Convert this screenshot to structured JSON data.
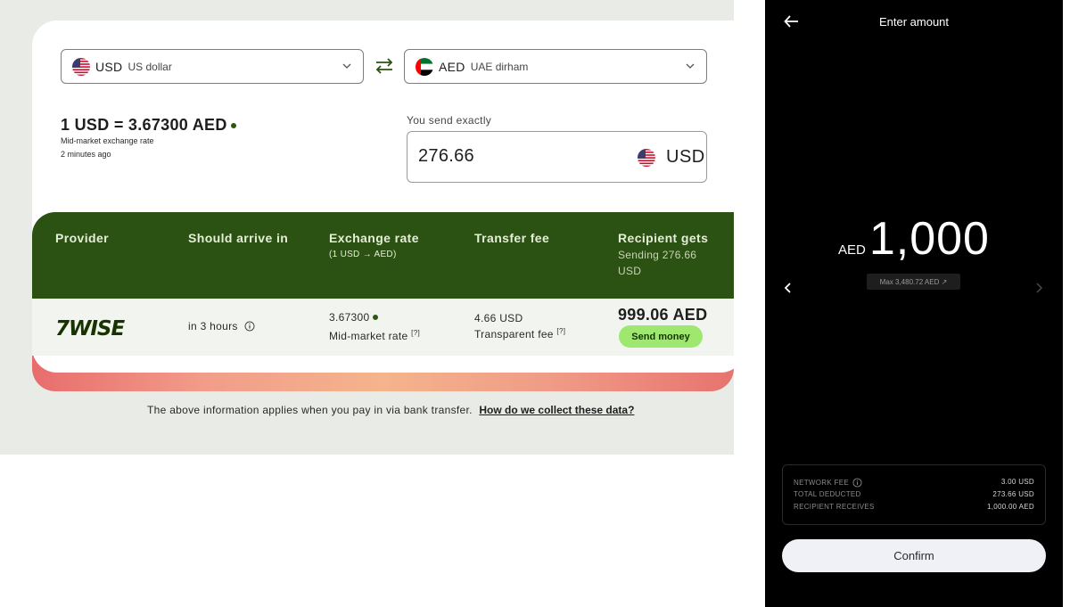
{
  "converter": {
    "from": {
      "code": "USD",
      "name": "US dollar",
      "flag_icon": "us-flag-icon"
    },
    "to": {
      "code": "AED",
      "name": "UAE dirham",
      "flag_icon": "uae-flag-icon"
    },
    "rate_text": "1 USD = 3.67300 AED",
    "rate_note": "Mid-market exchange rate",
    "rate_time": "2 minutes ago",
    "send_label": "You send exactly",
    "send_amount": "276.66",
    "send_currency": "USD"
  },
  "table": {
    "headers": {
      "provider": "Provider",
      "arrive": "Should arrive in",
      "rate": "Exchange rate",
      "rate_sub": "(1 USD → AED)",
      "fee": "Transfer fee",
      "recipient": "Recipient gets",
      "recipient_sub": "Sending 276.66 USD"
    },
    "row": {
      "provider": "7WISE",
      "arrive": "in 3 hours",
      "rate": "3.67300",
      "rate_note": "Mid-market rate",
      "note_mark": "[?]",
      "fee": "4.66 USD",
      "fee_note": "Transparent fee",
      "recipient": "999.06 AED",
      "action": "Send money"
    }
  },
  "footnote": {
    "text": "The above information applies when you pay in via bank transfer.",
    "link": "How do we collect these data?"
  },
  "panel": {
    "title": "Enter amount",
    "currency": "AED",
    "amount": "1,000",
    "max_label": "Max 3,480.72 AED ↗",
    "fees": [
      {
        "label": "NETWORK FEE",
        "value": "3.00 USD"
      },
      {
        "label": "TOTAL DEDUCTED",
        "value": "273.66 USD"
      },
      {
        "label": "RECIPIENT RECEIVES",
        "value": "1,000.00 AED"
      }
    ],
    "confirm": "Confirm"
  },
  "colors": {
    "brand_green": "#2b5212",
    "accent_green": "#9fe870",
    "panel_bg": "#000000"
  }
}
